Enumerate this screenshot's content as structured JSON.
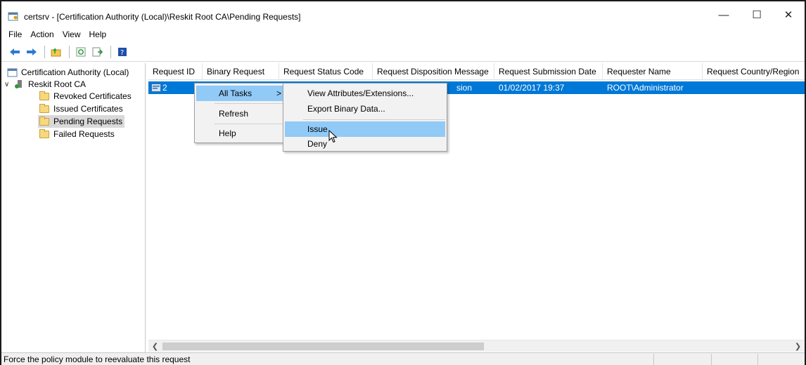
{
  "window": {
    "title": "certsrv - [Certification Authority (Local)\\Reskit Root CA\\Pending Requests]"
  },
  "menu": [
    "File",
    "Action",
    "View",
    "Help"
  ],
  "toolbar": {
    "icons": [
      "back-arrow-icon",
      "forward-arrow-icon",
      "up-folder-icon",
      "refresh-icon",
      "export-list-icon",
      "help-icon"
    ]
  },
  "tree": {
    "root": "Certification Authority (Local)",
    "ca": "Reskit Root CA",
    "items": [
      "Revoked Certificates",
      "Issued Certificates",
      "Pending Requests",
      "Failed Requests"
    ],
    "selected_index": 2
  },
  "list": {
    "columns": [
      "Request ID",
      "Binary Request",
      "Request Status Code",
      "Request Disposition Message",
      "Request Submission Date",
      "Requester Name",
      "Request Country/Region"
    ],
    "row": {
      "request_id": "2",
      "disposition_fragment": "sion",
      "submission_date": "01/02/2017 19:37",
      "requester": "ROOT\\Administrator"
    }
  },
  "context_menu": {
    "items": [
      "All Tasks",
      "Refresh",
      "Help"
    ],
    "submenu_arrow": ">",
    "submenu": [
      "View Attributes/Extensions...",
      "Export Binary Data...",
      "Issue",
      "Deny"
    ]
  },
  "status": {
    "message": "Force the policy module to reevaluate this request"
  },
  "colors": {
    "selection": "#0078d7",
    "menu_highlight": "#91c9f7"
  }
}
